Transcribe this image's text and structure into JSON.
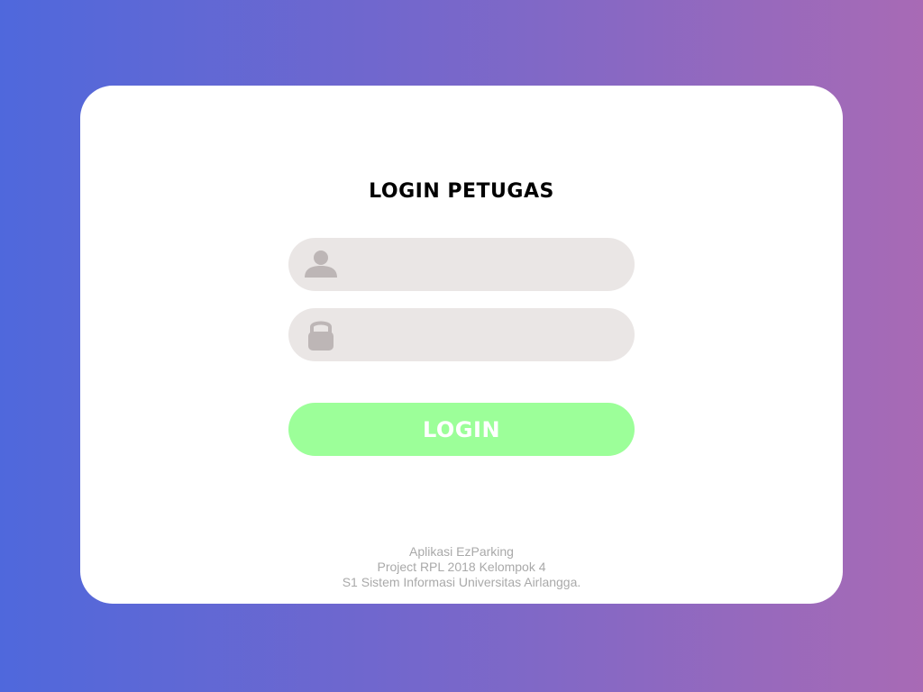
{
  "login": {
    "title": "LOGIN PETUGAS",
    "username": {
      "icon": "user-icon",
      "value": "",
      "placeholder": ""
    },
    "password": {
      "icon": "lock-icon",
      "value": "",
      "placeholder": ""
    },
    "button_label": "LOGIN"
  },
  "footer": {
    "line1": "Aplikasi EzParking",
    "line2": "Project RPL 2018 Kelompok 4",
    "line3": "S1 Sistem Informasi Universitas Airlangga."
  },
  "colors": {
    "background_start": "#4f68dc",
    "background_end": "#a86ab5",
    "field_background": "#eae6e5",
    "icon": "#bdb6b6",
    "button": "#9cff99",
    "footer_text": "#a9a9a9"
  }
}
